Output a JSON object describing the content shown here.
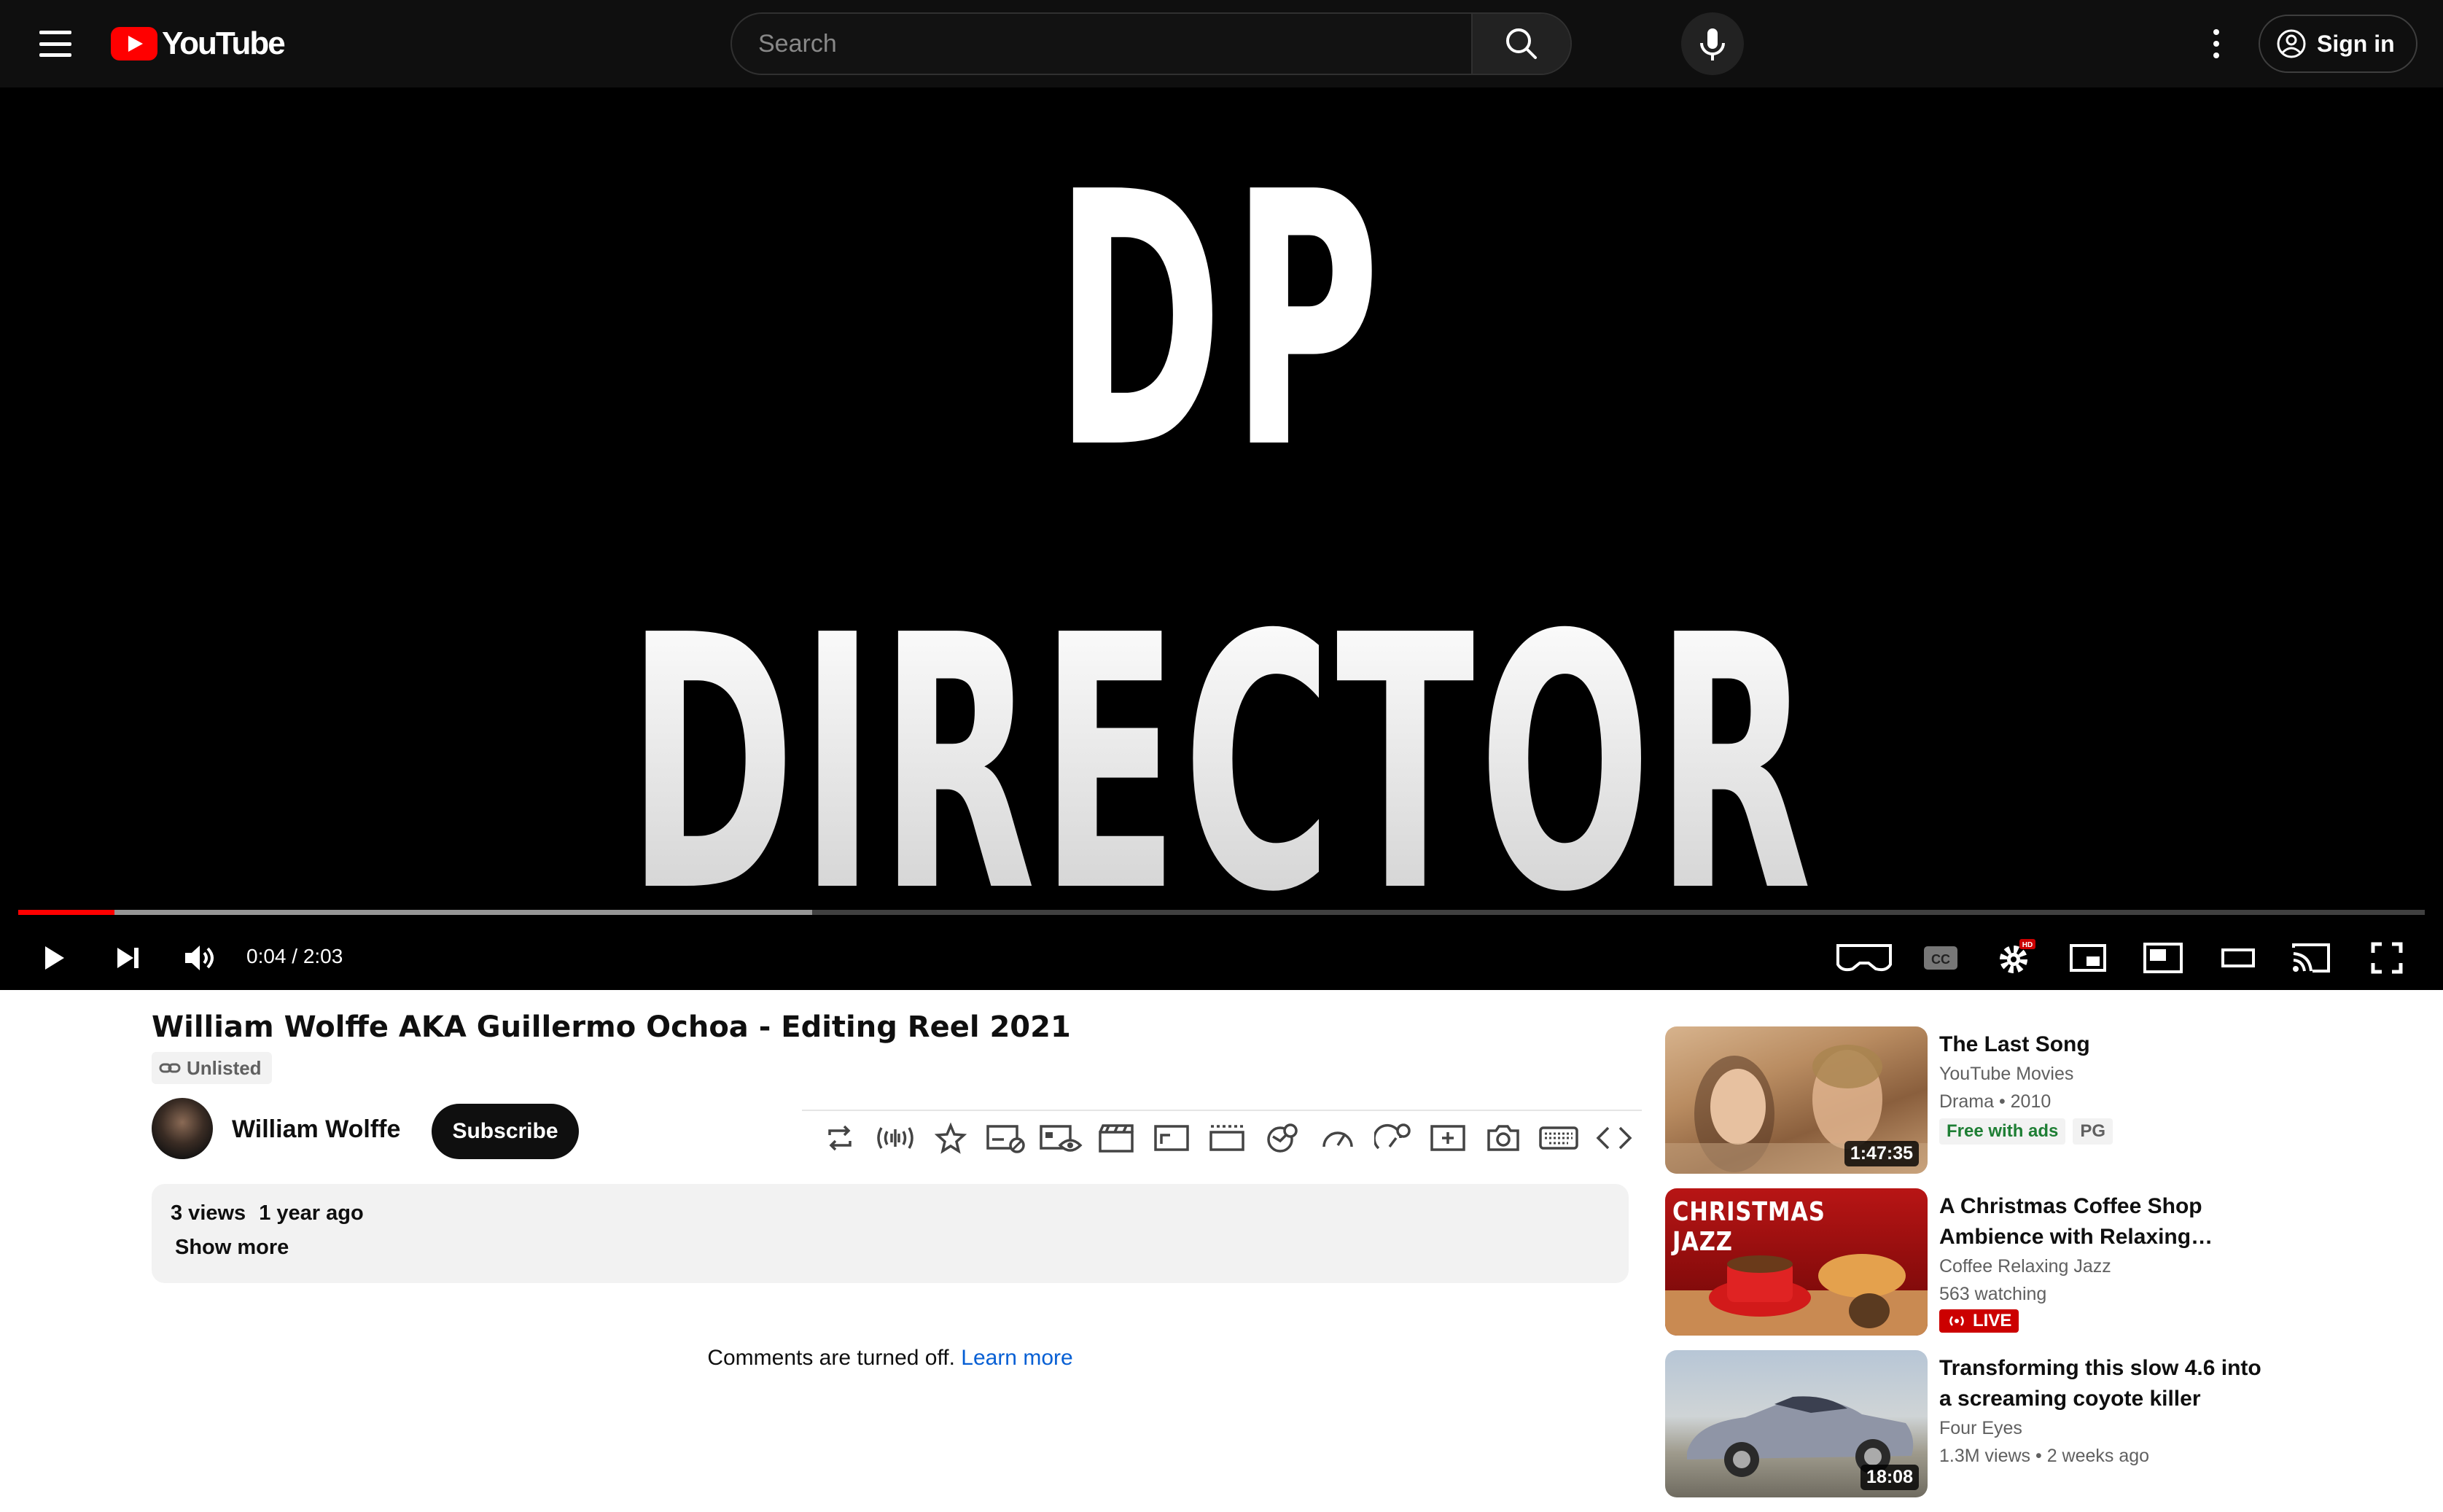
{
  "header": {
    "logo_text": "YouTube",
    "search_placeholder": "Search",
    "signin_label": "Sign in"
  },
  "player": {
    "frame_text_line1": "DP",
    "frame_text_line2": "DIRECTOR",
    "time_display": "0:04 / 2:03",
    "played_fraction": 0.04,
    "buffered_fraction": 0.33,
    "icons": [
      "play-icon",
      "next-icon",
      "volume-icon",
      "vr-icon",
      "captions-icon",
      "settings-icon",
      "miniplayer-icon",
      "theater-mode-icon",
      "wide-mode-icon",
      "cast-icon",
      "fullscreen-icon"
    ],
    "hd_badge": "HD",
    "cc_label": "CC"
  },
  "video": {
    "title": "William Wolffe AKA Guillermo Ochoa - Editing Reel 2021",
    "visibility": "Unlisted",
    "channel_name": "William Wolffe",
    "subscribe_label": "Subscribe",
    "views": "3 views",
    "age": "1 year ago",
    "show_more": "Show more",
    "comments_off": "Comments are turned off.",
    "learn_more": "Learn more",
    "toolbar_icons": [
      "loop-icon",
      "audio-icon",
      "star-icon",
      "ads-block-icon",
      "watched-icon",
      "cinema-icon",
      "frame-icon",
      "crop-icon",
      "filter-icon",
      "speed-icon",
      "speed-settings-icon",
      "add-icon",
      "screenshot-icon",
      "keyboard-icon",
      "code-icon"
    ]
  },
  "related": [
    {
      "title": "The Last Song",
      "channel": "YouTube Movies",
      "meta": "Drama • 2010",
      "duration": "1:47:35",
      "badge_free": "Free with ads",
      "badge_rating": "PG"
    },
    {
      "title": "A Christmas Coffee Shop Ambience with Relaxing…",
      "channel": "Coffee Relaxing Jazz",
      "meta": "563 watching",
      "live": "LIVE",
      "thumb_text": "CHRISTMAS JAZZ"
    },
    {
      "title": "Transforming this slow 4.6 into a screaming coyote killer",
      "channel": "Four Eyes",
      "views": "1.3M views",
      "age": "• 2 weeks ago",
      "duration": "18:08"
    }
  ],
  "colors": {
    "accent": "#ff0000",
    "header_bg": "#0f0f0f",
    "link": "#065fd4",
    "live": "#cc0000"
  }
}
